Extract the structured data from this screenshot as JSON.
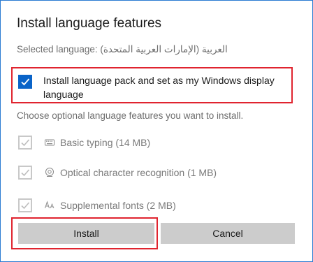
{
  "dialog": {
    "title": "Install language features",
    "selected_language_label": "Selected language:",
    "selected_language_value": "العربية (الإمارات العربية المتحدة)"
  },
  "language_pack": {
    "checked": true,
    "label": "Install language pack and set as my Windows display language"
  },
  "optional": {
    "heading": "Choose optional language features you want to install.",
    "features": [
      {
        "label": "Basic typing (14 MB)",
        "icon": "keyboard-icon",
        "checked": true,
        "enabled": false
      },
      {
        "label": "Optical character recognition (1 MB)",
        "icon": "ocr-eye-icon",
        "checked": true,
        "enabled": false
      },
      {
        "label": "Supplemental fonts (2 MB)",
        "icon": "font-icon",
        "checked": true,
        "enabled": false
      }
    ]
  },
  "buttons": {
    "install": "Install",
    "cancel": "Cancel"
  },
  "colors": {
    "accent": "#0a64c8",
    "highlight": "#e0242f",
    "window_border": "#2b7cd3",
    "button_bg": "#cccccc"
  }
}
